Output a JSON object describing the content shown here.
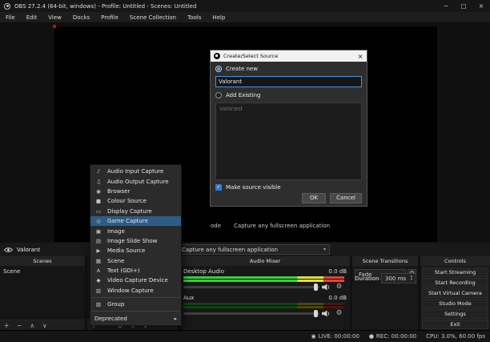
{
  "title_bar": {
    "title": "OBS 27.2.4 (64-bit, windows) - Profile: Untitled - Scenes: Untitled",
    "minimize_icon": "─",
    "maximize_icon": "□",
    "close_icon": "×"
  },
  "menu_bar": {
    "items": [
      "File",
      "Edit",
      "View",
      "Docks",
      "Profile",
      "Scene Collection",
      "Tools",
      "Help"
    ]
  },
  "icons": {
    "caret_down": "▾",
    "spin_up": "▴",
    "spin_down": "▾",
    "gear": "⚙",
    "live": "◉",
    "rec": "●",
    "check": "✓",
    "submenu_arrow": "▸"
  },
  "dialog": {
    "title": "Create/Select Source",
    "close_icon": "×",
    "create_new": "Create new",
    "source_name": "Valorant",
    "add_existing": "Add Existing",
    "existing_items": [
      {
        "label": "Valorant"
      }
    ],
    "make_source_visible": "Make source visible",
    "ok": "OK",
    "cancel": "Cancel"
  },
  "properties_window": {
    "source_name": "Valorant",
    "mode_label_fragment": "ode",
    "mode_value": "Capture any fullscreen application",
    "combo_value": "Capture any fullscreen application"
  },
  "add_source_menu": {
    "items": [
      {
        "icon": "♪",
        "label": "Audio Input Capture"
      },
      {
        "icon": "♫",
        "label": "Audio Output Capture"
      },
      {
        "icon": "◉",
        "label": "Browser"
      },
      {
        "icon": "■",
        "label": "Colour Source"
      },
      {
        "icon": "▭",
        "label": "Display Capture"
      },
      {
        "icon": "◎",
        "label": "Game Capture"
      },
      {
        "icon": "▣",
        "label": "Image"
      },
      {
        "icon": "▤",
        "label": "Image Slide Show"
      },
      {
        "icon": "▶",
        "label": "Media Source"
      },
      {
        "icon": "▦",
        "label": "Scene"
      },
      {
        "icon": "A",
        "label": "Text (GDI+)"
      },
      {
        "icon": "◆",
        "label": "Video Capture Device"
      },
      {
        "icon": "▥",
        "label": "Window Capture"
      }
    ],
    "highlighted_item": "Game Capture",
    "group_item": {
      "icon": "▧",
      "label": "Group"
    },
    "deprecated_item": {
      "label": "Deprecated"
    }
  },
  "scenes_dock": {
    "header": "Scenes",
    "items": [
      {
        "label": "Scene"
      }
    ],
    "toolbar": [
      "+",
      "−",
      "∧",
      "∨"
    ]
  },
  "sources_dock": {
    "toolbar": [
      "+",
      "−",
      "⚙",
      "∧",
      "∨"
    ]
  },
  "audio_mixer": {
    "header": "Audio Mixer",
    "channels": [
      {
        "name": "Desktop Audio",
        "level_db": "0.0 dB"
      },
      {
        "name": "Aux",
        "level_db": "0.0 dB"
      }
    ]
  },
  "scene_transitions": {
    "header": "Scene Transitions",
    "transition": "Fade",
    "duration_label": "Duration",
    "duration_value": "300 ms"
  },
  "controls": {
    "header": "Controls",
    "buttons": [
      "Start Streaming",
      "Start Recording",
      "Start Virtual Camera",
      "Studio Mode",
      "Settings",
      "Exit"
    ]
  },
  "status_bar": {
    "live": "LIVE: 00:00:00",
    "rec": "REC: 00:00:00",
    "stats": "CPU: 3.0%, 60.00 fps"
  },
  "colors": {
    "menu_highlight": "#2d5c84",
    "checkbox_blue": "#2d7dd2",
    "focus_border": "#4a90d9",
    "meter_green": "#35d435",
    "meter_yellow": "#e0e038",
    "meter_red": "#e04438",
    "canvas_handle_red": "#e20000"
  }
}
